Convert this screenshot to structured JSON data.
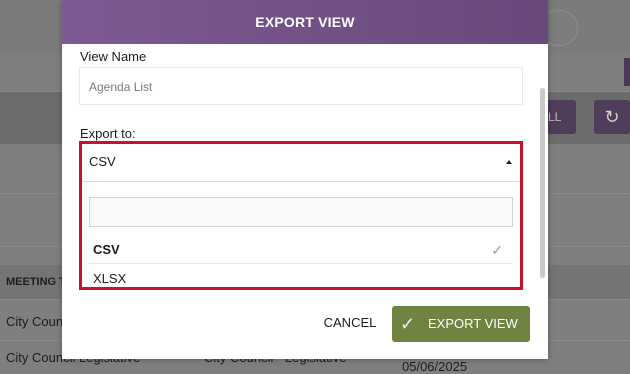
{
  "background": {
    "table_header": "MEETING T",
    "rows": [
      {
        "col1": "City Counc",
        "col2": "",
        "col3": ""
      },
      {
        "col1": "City Council Legislative",
        "col2": "City Council - Legislative",
        "col3": "05/06/2025"
      }
    ],
    "toolbar_button_1": "LL",
    "toolbar_button_2_icon": "refresh-icon"
  },
  "modal": {
    "title": "EXPORT VIEW",
    "view_name_label": "View Name",
    "view_name_placeholder": "Agenda List",
    "export_to_label": "Export to:",
    "selected_format": "CSV",
    "dropdown_search_value": "",
    "options": [
      {
        "label": "CSV",
        "selected": true
      },
      {
        "label": "XLSX",
        "selected": false
      }
    ],
    "cancel_label": "CANCEL",
    "export_label": "EXPORT VIEW",
    "check_glyph": "✓"
  },
  "colors": {
    "header_purple": "#74528a",
    "highlight_red": "#c4122f",
    "export_green": "#6e8440"
  }
}
